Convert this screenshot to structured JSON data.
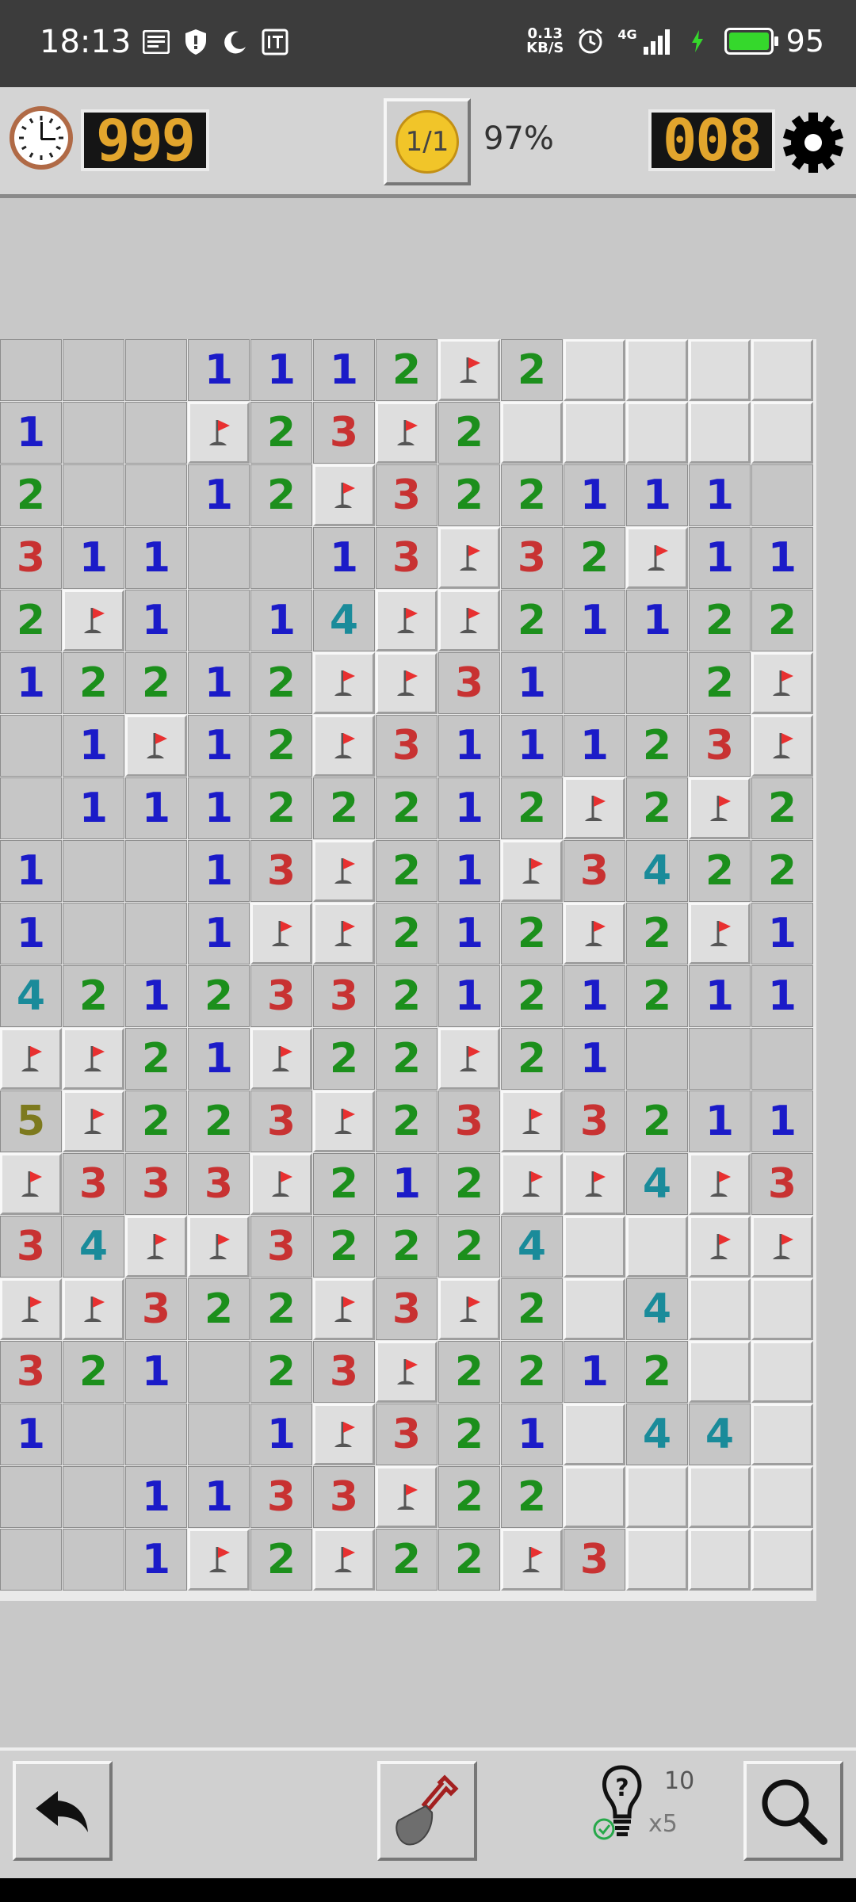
{
  "status_bar": {
    "time": "18:13",
    "net_speed_value": "0.13",
    "net_speed_unit": "KB/S",
    "network": "4G",
    "battery": "95"
  },
  "top_bar": {
    "timer": "999",
    "smiley_label": "1/1",
    "progress": "97%",
    "mine_counter": "008"
  },
  "bottom_bar": {
    "hint_count": "10",
    "hint_multiplier": "x5"
  },
  "icons": {
    "clock": "clock-icon",
    "settings": "gear-icon",
    "undo": "undo-arrow-icon",
    "dig": "shovel-icon",
    "hint": "lightbulb-question-icon",
    "zoom": "magnifier-icon",
    "flag": "flag-icon"
  },
  "colors": {
    "lcd_digit": "#e2a52d",
    "n1": "#1b1bc8",
    "n2": "#1c8f1c",
    "n3": "#c83232",
    "n4": "#1a8b9a",
    "n5": "#7d7a1e",
    "flag": "#e83030"
  },
  "board": {
    "legend": "0-8 = revealed number (0 blank), F = flagged cell, C = covered cell",
    "rows": [
      "0001112F2CCCC",
      "100F23F2CCCCC",
      "20012F322111",
      "3110013F32F11F",
      "2F1014FF21122",
      "12212FF31002F",
      "01F12F31112 3F",
      "0111222 12F2F2",
      "10013F21F3422",
      "1001FF212F2F1",
      "4212332121211",
      "FF21F22F21000",
      "5F223F23F3211",
      "F333F212FF4F3",
      "34FF32224CCFF",
      "FF322F3F2C4CC",
      "321023F2212CC",
      "10001F321C44C",
      "00113 3F22CCCC",
      "001F2F22F3CCC"
    ]
  }
}
